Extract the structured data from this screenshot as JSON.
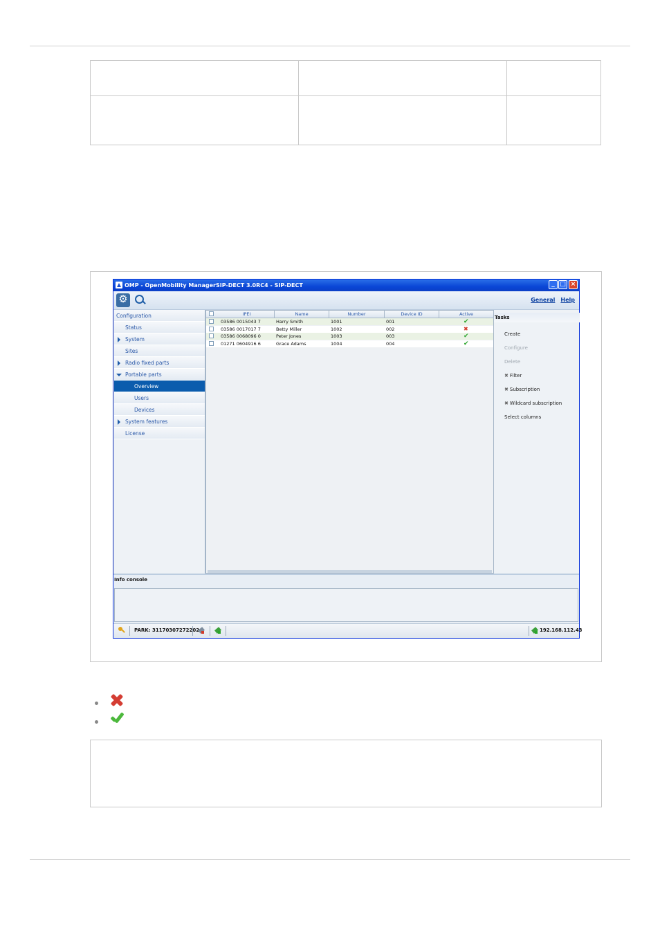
{
  "window": {
    "title": "OMP - OpenMobility ManagerSIP-DECT 3.0RC4 - SIP-DECT",
    "links": [
      "General",
      "Help"
    ]
  },
  "nav": {
    "items": [
      {
        "label": "Configuration",
        "indent": 0,
        "arrow": "none",
        "selected": false
      },
      {
        "label": "Status",
        "indent": 1,
        "arrow": "none",
        "selected": false
      },
      {
        "label": "System",
        "indent": 1,
        "arrow": "right",
        "selected": false
      },
      {
        "label": "Sites",
        "indent": 1,
        "arrow": "none",
        "selected": false
      },
      {
        "label": "Radio fixed parts",
        "indent": 1,
        "arrow": "right",
        "selected": false
      },
      {
        "label": "Portable parts",
        "indent": 1,
        "arrow": "down",
        "selected": false
      },
      {
        "label": "Overview",
        "indent": 2,
        "arrow": "none",
        "selected": true
      },
      {
        "label": "Users",
        "indent": 2,
        "arrow": "none",
        "selected": false
      },
      {
        "label": "Devices",
        "indent": 2,
        "arrow": "none",
        "selected": false
      },
      {
        "label": "System features",
        "indent": 1,
        "arrow": "right",
        "selected": false
      },
      {
        "label": "License",
        "indent": 1,
        "arrow": "none",
        "selected": false
      }
    ]
  },
  "table": {
    "columns": [
      "IPEI",
      "Name",
      "Number",
      "Device ID",
      "Active"
    ],
    "rows": [
      {
        "ipei": "03586 0015043 7",
        "name": "Harry Smith",
        "number": "1001",
        "device_id": "001",
        "active": true
      },
      {
        "ipei": "03586 0017017 7",
        "name": "Betty Miller",
        "number": "1002",
        "device_id": "002",
        "active": false
      },
      {
        "ipei": "03586 0068096 0",
        "name": "Peter Jones",
        "number": "1003",
        "device_id": "003",
        "active": true
      },
      {
        "ipei": "01271 0604916 6",
        "name": "Grace Adams",
        "number": "1004",
        "device_id": "004",
        "active": true
      }
    ]
  },
  "tasks": {
    "header": "Tasks",
    "items": [
      {
        "label": "Create",
        "disabled": false,
        "prefix": ""
      },
      {
        "label": "Configure",
        "disabled": true,
        "prefix": ""
      },
      {
        "label": "Delete",
        "disabled": true,
        "prefix": ""
      },
      {
        "label": "Filter",
        "disabled": false,
        "prefix": "✖"
      },
      {
        "label": "Subscription",
        "disabled": false,
        "prefix": "✖"
      },
      {
        "label": "Wildcard subscription",
        "disabled": false,
        "prefix": "✖"
      },
      {
        "label": "Select columns",
        "disabled": false,
        "prefix": ""
      }
    ]
  },
  "info_console": {
    "label": "Info console"
  },
  "statusbar": {
    "park": "PARK: 31170307272202",
    "ip": "192.168.112.43"
  },
  "legend": {
    "icons": [
      "red-x-icon",
      "green-check-icon"
    ]
  },
  "colors": {
    "selected": "#0b5cad",
    "link": "#2a58a8",
    "active_ok": "#2aa52a",
    "inactive": "#d23a2a"
  }
}
